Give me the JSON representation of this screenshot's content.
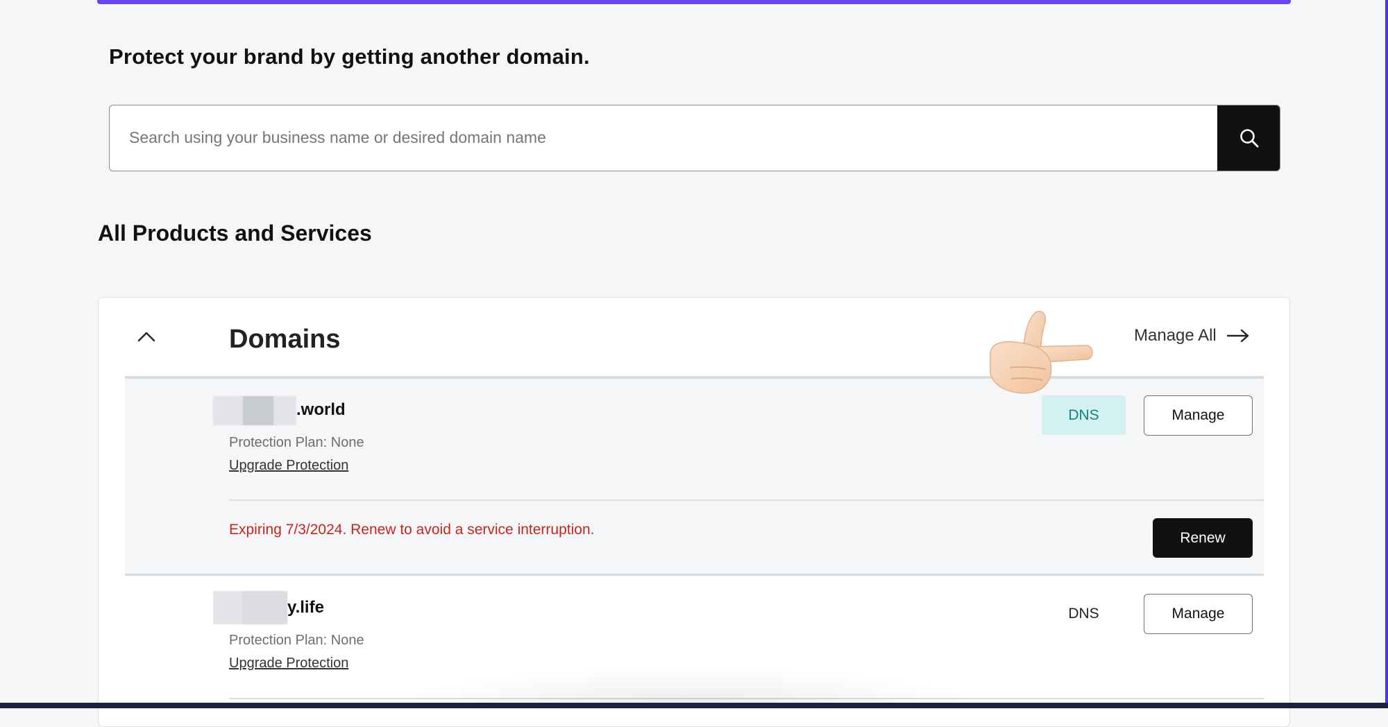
{
  "promo": {
    "heading": "Protect your brand by getting another domain.",
    "search_placeholder": "Search using your business name or desired domain name",
    "search_value": ""
  },
  "section": {
    "heading": "All Products and Services"
  },
  "domains_card": {
    "title": "Domains",
    "manage_all_label": "Manage All",
    "items": [
      {
        "name_suffix": ".world",
        "protection": "Protection Plan: None",
        "upgrade_label": "Upgrade Protection",
        "dns_label": "DNS",
        "manage_label": "Manage",
        "expiry_message": "Expiring 7/3/2024. Renew to avoid a service interruption.",
        "renew_label": "Renew"
      },
      {
        "name_suffix": "y.life",
        "protection": "Protection Plan: None",
        "upgrade_label": "Upgrade Protection",
        "dns_label": "DNS",
        "manage_label": "Manage"
      }
    ]
  },
  "colors": {
    "accent_top": "#6a45f0",
    "dns_active_bg": "#d3f1f1",
    "dns_active_text": "#11807f",
    "expiry_text": "#c4261d",
    "primary_button": "#111111"
  },
  "icons": {
    "search": "search-icon",
    "collapse": "chevron-up-icon",
    "manage_all": "arrow-right-icon",
    "pointer": "pointing-hand-icon"
  }
}
